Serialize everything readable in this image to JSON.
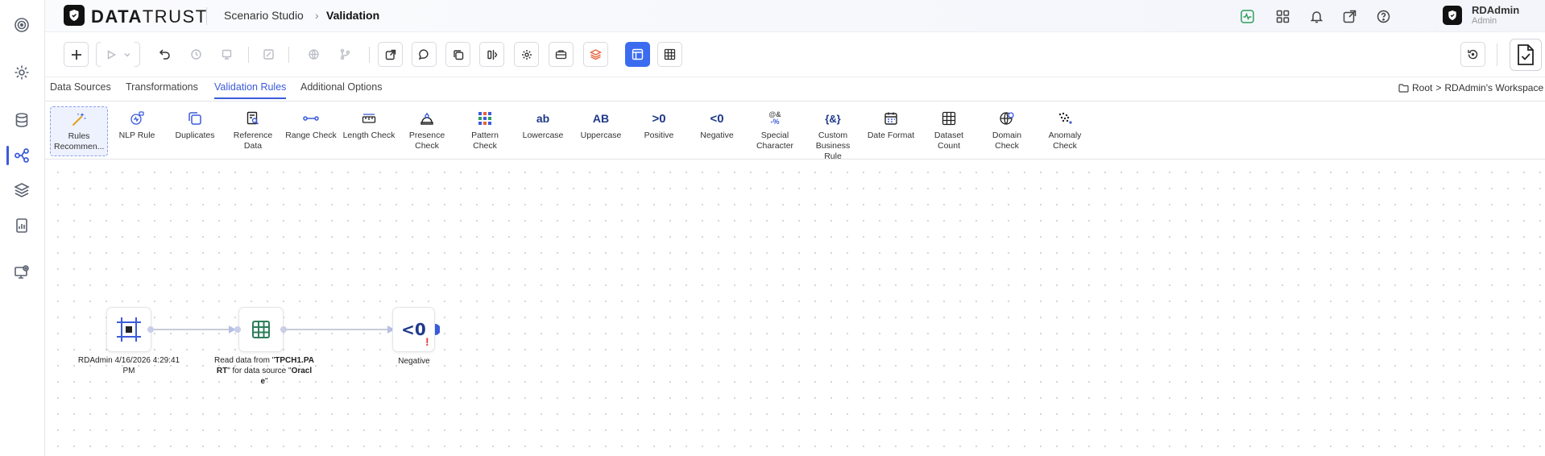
{
  "app": {
    "brand_bold": "DATA",
    "brand_thin": "TRUST",
    "breadcrumb": [
      "Scenario Studio",
      "Validation"
    ],
    "user": {
      "name": "RDAdmin",
      "role": "Admin"
    }
  },
  "rail": {
    "items": [
      "target-icon",
      "settings-icon",
      "database-icon",
      "workflow-icon",
      "layers-icon",
      "report-icon",
      "monitor-settings-icon"
    ],
    "active": "workflow-icon"
  },
  "header_icons": [
    "activity-icon",
    "apps-grid-icon",
    "bell-icon",
    "external-link-icon",
    "help-icon"
  ],
  "toolbar": {
    "buttons": [
      "add",
      "run",
      "run-options",
      "undo",
      "history",
      "save",
      "edit",
      "globe",
      "branch",
      "export",
      "comment",
      "copy",
      "compare",
      "settings",
      "toolbox",
      "layers",
      "diagram-view",
      "table-view",
      "restore",
      "validate"
    ],
    "active": "diagram-view"
  },
  "tabs": {
    "items": [
      "Data Sources",
      "Transformations",
      "Validation Rules",
      "Additional Options"
    ],
    "active": "Validation Rules",
    "path_root": "Root",
    "path_sep": ">",
    "path_workspace": "RDAdmin's Workspace"
  },
  "palette": {
    "items": [
      {
        "label": "Rules Recommen...",
        "icon": "magic-wand-icon"
      },
      {
        "label": "NLP Rule",
        "icon": "nlp-icon"
      },
      {
        "label": "Duplicates",
        "icon": "duplicates-icon"
      },
      {
        "label": "Reference Data",
        "icon": "reference-data-icon"
      },
      {
        "label": "Range Check",
        "icon": "range-icon"
      },
      {
        "label": "Length Check",
        "icon": "ruler-icon"
      },
      {
        "label": "Presence Check",
        "icon": "presence-icon"
      },
      {
        "label": "Pattern Check",
        "icon": "pattern-icon"
      },
      {
        "label": "Lowercase",
        "icon": "lowercase-icon"
      },
      {
        "label": "Uppercase",
        "icon": "uppercase-icon"
      },
      {
        "label": "Positive",
        "icon": "positive-icon"
      },
      {
        "label": "Negative",
        "icon": "negative-icon"
      },
      {
        "label": "Special Character",
        "icon": "special-character-icon"
      },
      {
        "label": "Custom Business Rule",
        "icon": "custom-rule-icon"
      },
      {
        "label": "Date Format",
        "icon": "calendar-icon"
      },
      {
        "label": "Dataset Count",
        "icon": "dataset-count-icon"
      },
      {
        "label": "Domain Check",
        "icon": "domain-icon"
      },
      {
        "label": "Anomaly Check",
        "icon": "anomaly-icon"
      }
    ],
    "selected": "Rules Recommen..."
  },
  "palette_glyphs": {
    "lowercase": "ab",
    "uppercase": "AB",
    "positive": ">0",
    "negative": "<0",
    "special": "@&",
    "special_sub": "-%",
    "custom": "{&}"
  },
  "canvas": {
    "nodes": [
      {
        "id": "start",
        "label": "RDAdmin 4/16/2026 4:29:41 PM"
      },
      {
        "id": "read",
        "label_pre": "Read data from \"",
        "label_table": "TPCH1.PART",
        "label_mid": "\" for data source \"",
        "label_source": "Oracle",
        "label_post": "\""
      },
      {
        "id": "negative",
        "label": "Negative",
        "glyph": "<0",
        "warning": "!"
      }
    ]
  },
  "colors": {
    "accent": "#3b5bdb",
    "toolbar_active": "#3b6cf0",
    "node_green": "#2e7d5a",
    "warning": "#e53935"
  }
}
